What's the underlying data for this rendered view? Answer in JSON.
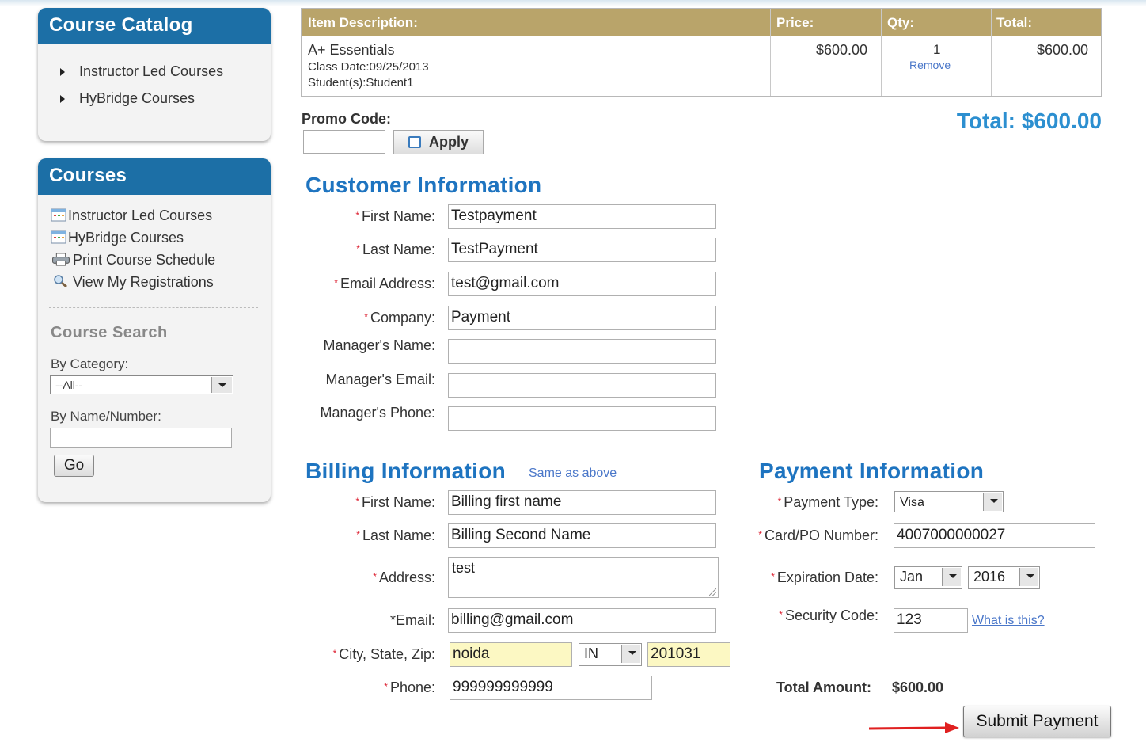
{
  "sidebar": {
    "catalog": {
      "title": "Course Catalog",
      "items": [
        "Instructor Led Courses",
        "HyBridge Courses"
      ]
    },
    "courses": {
      "title": "Courses",
      "items": [
        {
          "label": "Instructor Led Courses",
          "icon": "calendar-icon"
        },
        {
          "label": "HyBridge Courses",
          "icon": "calendar-icon"
        },
        {
          "label": "Print Course Schedule",
          "icon": "printer-icon"
        },
        {
          "label": "View My Registrations",
          "icon": "magnifier-icon"
        }
      ],
      "search_title": "Course Search",
      "by_category_label": "By Category:",
      "category_value": "--All--",
      "by_name_label": "By Name/Number:",
      "go_label": "Go"
    }
  },
  "cart": {
    "headers": {
      "description": "Item Description:",
      "price": "Price:",
      "qty": "Qty:",
      "total": "Total:"
    },
    "item": {
      "name": "A+ Essentials",
      "class_date": "Class Date:09/25/2013",
      "students": "Student(s):Student1",
      "price": "$600.00",
      "qty": "1",
      "remove": "Remove",
      "total": "$600.00"
    },
    "header_color": "#b9a46a"
  },
  "promo": {
    "label": "Promo Code:",
    "value": "",
    "apply_label": "Apply"
  },
  "grand_total": "Total: $600.00",
  "customer": {
    "heading": "Customer Information",
    "fields": {
      "first_name": {
        "label": "First Name:",
        "value": "Testpayment"
      },
      "last_name": {
        "label": "Last Name:",
        "value": "TestPayment"
      },
      "email": {
        "label": "Email Address:",
        "value": "test@gmail.com"
      },
      "company": {
        "label": "Company:",
        "value": "Payment"
      },
      "manager_name": {
        "label": "Manager's Name:",
        "value": ""
      },
      "manager_email": {
        "label": "Manager's Email:",
        "value": ""
      },
      "manager_phone": {
        "label": "Manager's Phone:",
        "value": ""
      }
    }
  },
  "billing": {
    "heading": "Billing Information",
    "same_as_above": "Same as above",
    "fields": {
      "first_name": {
        "label": "First Name:",
        "value": "Billing first name"
      },
      "last_name": {
        "label": "Last Name:",
        "value": "Billing Second Name"
      },
      "address": {
        "label": "Address:",
        "value": "test"
      },
      "email": {
        "label": "*Email:",
        "value": "billing@gmail.com"
      },
      "city_state_zip": {
        "label": "City, State, Zip:",
        "city": "noida",
        "state": "IN",
        "zip": "201031"
      },
      "phone": {
        "label": "Phone:",
        "value": "999999999999"
      }
    }
  },
  "payment": {
    "heading": "Payment Information",
    "fields": {
      "payment_type": {
        "label": "Payment Type:",
        "value": "Visa"
      },
      "card_number": {
        "label": "Card/PO Number:",
        "value": "4007000000027"
      },
      "expiration": {
        "label": "Expiration Date:",
        "month": "Jan",
        "year": "2016"
      },
      "security_code": {
        "label": "Security Code:",
        "value": "123",
        "help_link": "What is this?"
      }
    },
    "total_amount_label": "Total Amount:",
    "total_amount_value": "$600.00",
    "submit_label": "Submit Payment"
  },
  "colors": {
    "panel_header": "#1c6fa6",
    "section_heading": "#1e74c0",
    "total_text": "#2c8fd0",
    "link": "#4a77c9",
    "required_star": "#d23",
    "highlight_field": "#fcf8c3",
    "annotation_arrow": "#e02020"
  }
}
